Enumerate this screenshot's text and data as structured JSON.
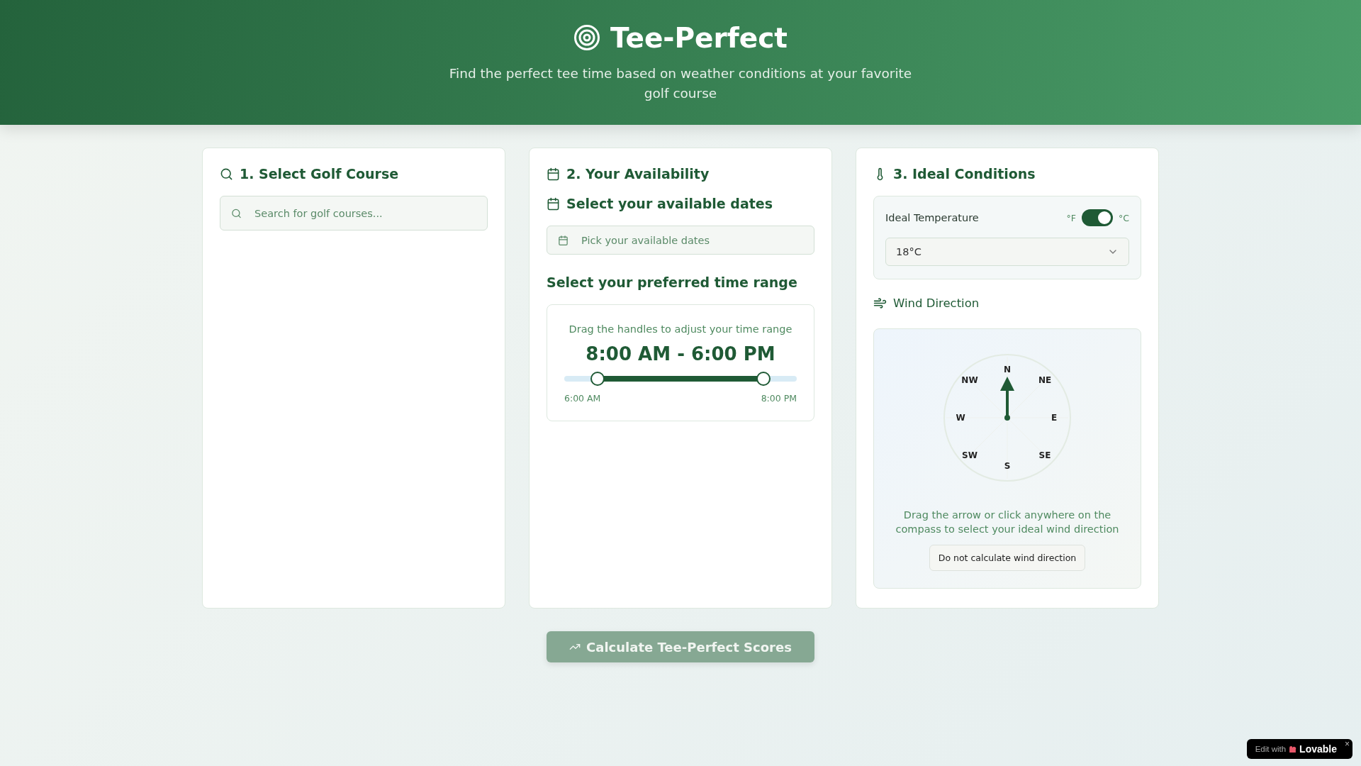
{
  "header": {
    "title": "Tee-Perfect",
    "subtitle": "Find the perfect tee time based on weather conditions at your favorite golf course"
  },
  "course_card": {
    "title": "1. Select Golf Course",
    "search": {
      "placeholder": "Search for golf courses..."
    }
  },
  "availability_card": {
    "title": "2. Your Availability",
    "dates_heading": "Select your available dates",
    "date_field": {
      "placeholder": "Pick your available dates"
    },
    "time_heading": "Select your preferred time range",
    "time_range": {
      "hint": "Drag the handles to adjust your time range",
      "reading": "8:00 AM - 6:00 PM",
      "start": {
        "level": 0.143
      },
      "end": {
        "level": 0.857
      },
      "min_label": "6:00 AM",
      "max_label": "8:00 PM"
    }
  },
  "conditions_card": {
    "title": "3. Ideal Conditions",
    "temperature": {
      "label": "Ideal Temperature",
      "unit_left": "°F",
      "unit_right": "°C",
      "celsius": {
        "on": true
      },
      "value": "18°C"
    },
    "wind": {
      "title": "Wind Direction",
      "compass_points": [
        "N",
        "NW",
        "NE",
        "W",
        "E",
        "SW",
        "SE",
        "S"
      ],
      "hint": "Drag the arrow or click anywhere on the compass to select your ideal wind direction",
      "skip_button": "Do not calculate wind direction"
    }
  },
  "calculate_button": {
    "label": "Calculate Tee-Perfect Scores",
    "disabled": true
  },
  "badge": {
    "prefix": "Edit with",
    "brand": "Lovable",
    "close": "×"
  }
}
